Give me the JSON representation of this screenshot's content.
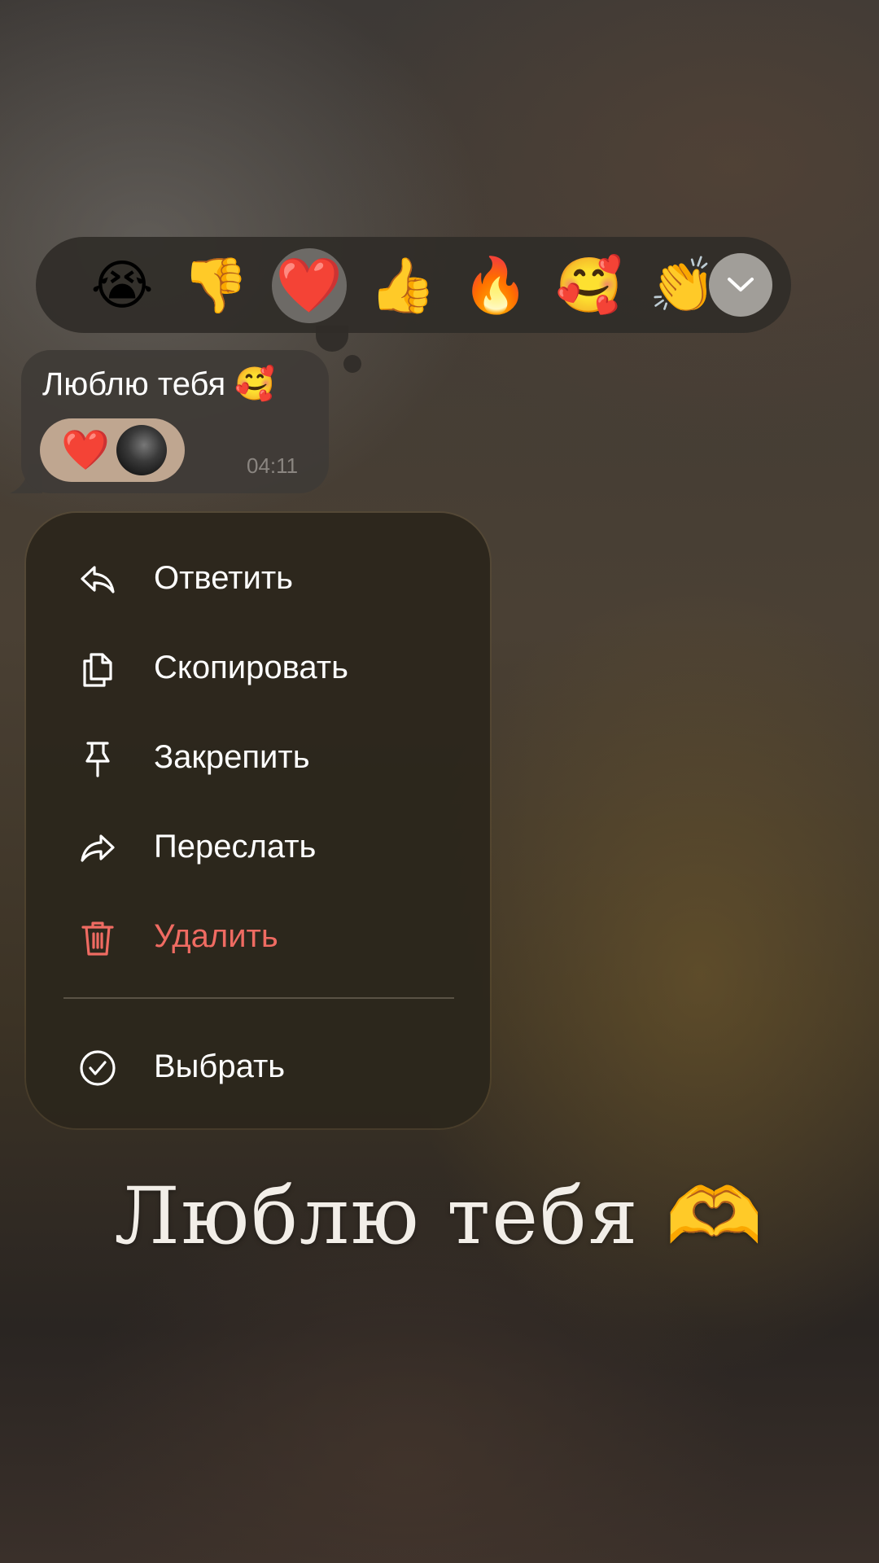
{
  "reactions": [
    {
      "emoji": "😭",
      "name": "loudly-crying-face"
    },
    {
      "emoji": "👎",
      "name": "thumbs-down"
    },
    {
      "emoji": "❤️",
      "name": "red-heart",
      "selected": true
    },
    {
      "emoji": "👍",
      "name": "thumbs-up"
    },
    {
      "emoji": "🔥",
      "name": "fire"
    },
    {
      "emoji": "🥰",
      "name": "smiling-face-with-hearts"
    },
    {
      "emoji": "👏",
      "name": "clapping-hands"
    }
  ],
  "reaction_expand_icon": "chevron-down-icon",
  "message": {
    "text": "Люблю тебя",
    "emoji": "🥰",
    "reaction_emoji": "❤️",
    "time": "04:11"
  },
  "menu": {
    "items": [
      {
        "label": "Ответить",
        "icon": "reply-icon"
      },
      {
        "label": "Скопировать",
        "icon": "copy-icon"
      },
      {
        "label": "Закрепить",
        "icon": "pin-icon"
      },
      {
        "label": "Переслать",
        "icon": "forward-icon"
      },
      {
        "label": "Удалить",
        "icon": "trash-icon",
        "danger": true
      },
      {
        "label": "Выбрать",
        "icon": "check-circle-icon"
      }
    ]
  },
  "caption": {
    "text": "Люблю тебя",
    "emoji": "🫶"
  },
  "colors": {
    "danger": "#ef6b62",
    "menu_bg": "#2c271c",
    "selected_reaction_bg": "#6d6a66"
  }
}
